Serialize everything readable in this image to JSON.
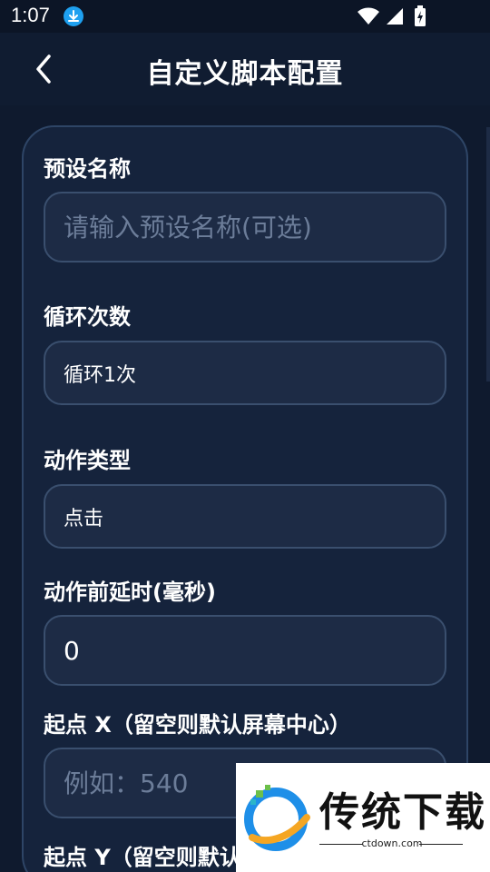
{
  "status_bar": {
    "time": "1:07",
    "icons": [
      "download-icon",
      "wifi-icon",
      "signal-icon",
      "battery-icon"
    ]
  },
  "header": {
    "title": "自定义脚本配置",
    "back_icon": "chevron-left-icon"
  },
  "form": {
    "preset_name": {
      "label": "预设名称",
      "placeholder": "请输入预设名称(可选)",
      "value": ""
    },
    "loop_count": {
      "label": "循环次数",
      "value": "循环1次"
    },
    "action_type": {
      "label": "动作类型",
      "value": "点击"
    },
    "pre_delay": {
      "label": "动作前延时(毫秒)",
      "value": "0"
    },
    "start_x": {
      "label": "起点 X（留空则默认屏幕中心）",
      "placeholder": "例如：540"
    },
    "start_y": {
      "label": "起点 Y（留空则默认屏幕中心）"
    }
  },
  "watermark": {
    "brand": "传统下载",
    "url": "ctdown.com"
  },
  "colors": {
    "background": "#0f1a2e",
    "card": "#15233c",
    "input": "#1d2b45",
    "border": "#3a4f6e",
    "accent_blue": "#1ea0f0"
  }
}
